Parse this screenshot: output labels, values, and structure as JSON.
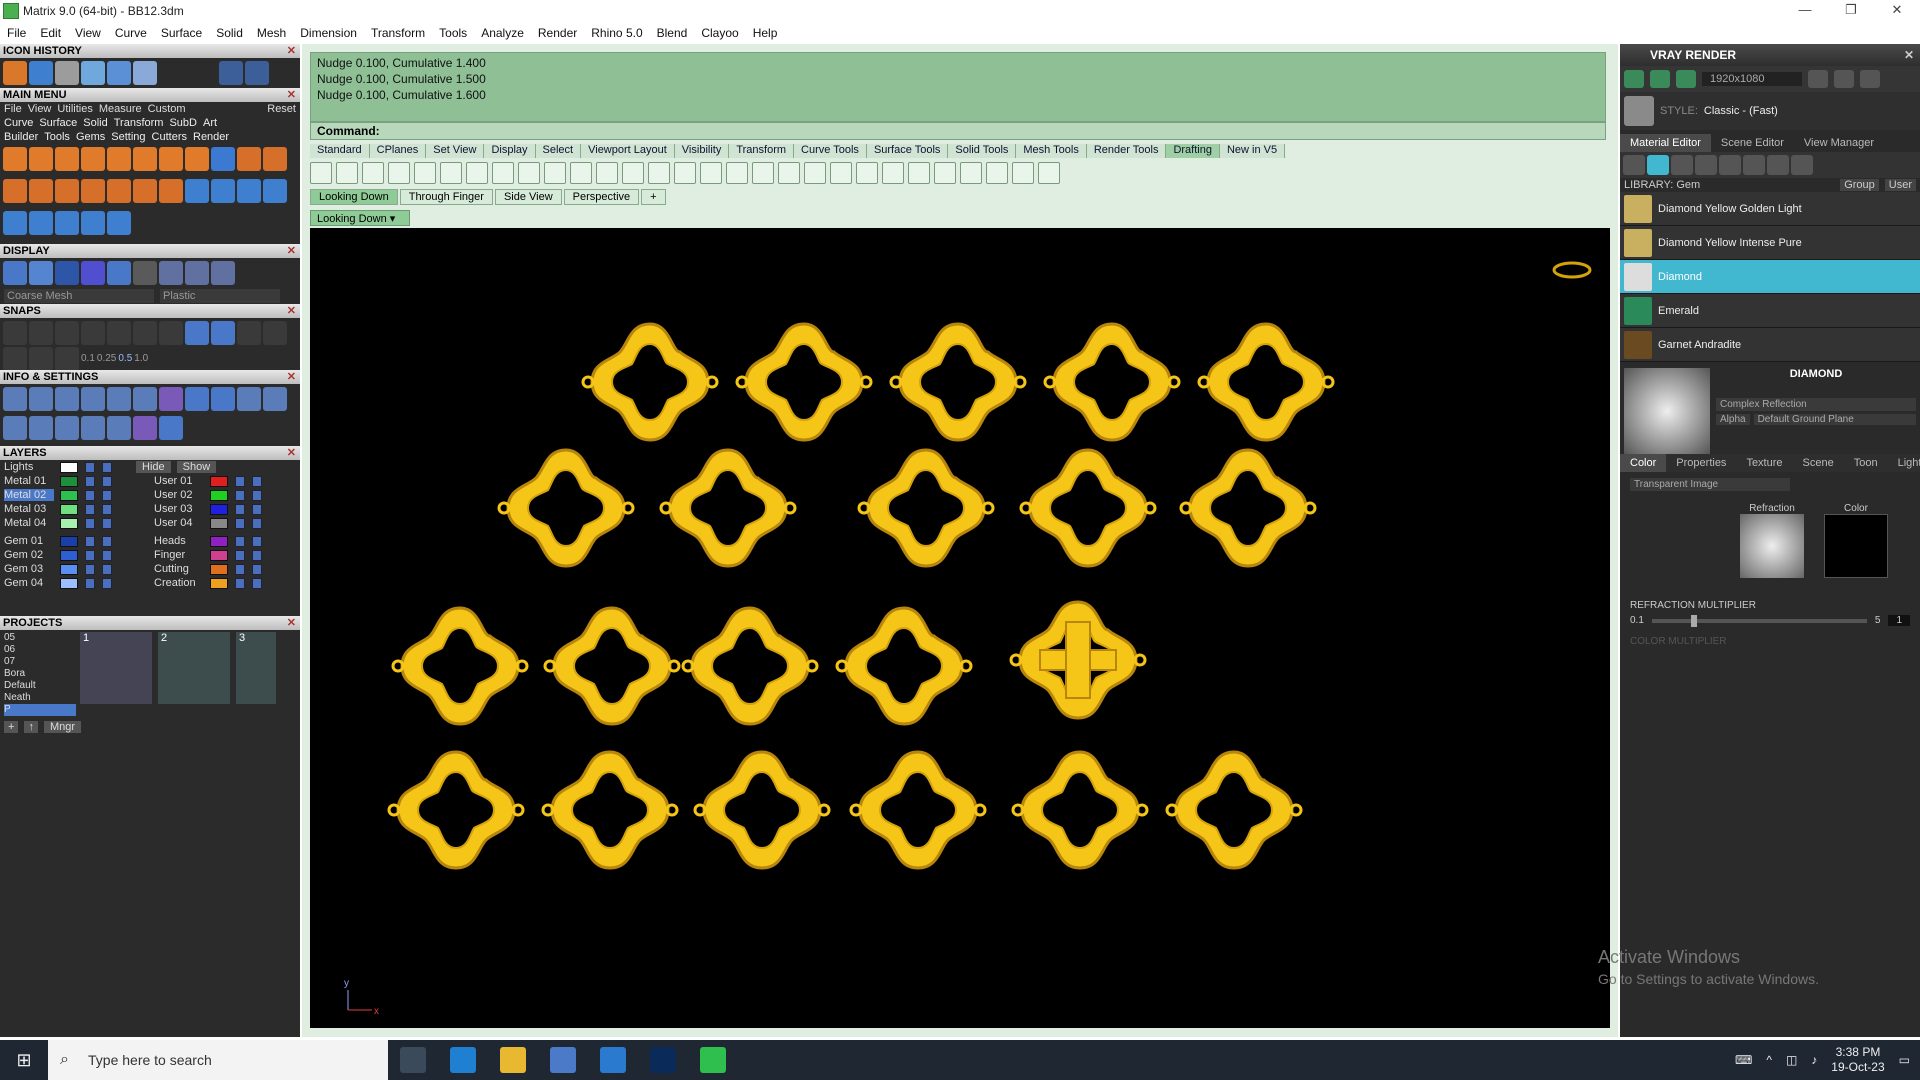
{
  "window": {
    "title": "Matrix 9.0 (64-bit) - BB12.3dm",
    "controls": [
      "—",
      "❐",
      "✕"
    ]
  },
  "menubar": [
    "File",
    "Edit",
    "View",
    "Curve",
    "Surface",
    "Solid",
    "Mesh",
    "Dimension",
    "Transform",
    "Tools",
    "Analyze",
    "Render",
    "Rhino 5.0",
    "Blend",
    "Clayoo",
    "Help"
  ],
  "left_panel": {
    "icon_history": "ICON HISTORY",
    "main_menu": "MAIN MENU",
    "main_menu_items": [
      "File",
      "View",
      "Utilities",
      "Measure",
      "Custom"
    ],
    "reset": "Reset",
    "categories_row1": [
      "Curve",
      "Surface",
      "Solid",
      "Transform",
      "SubD",
      "Art"
    ],
    "categories_row2": [
      "Builder",
      "Tools",
      "Gems",
      "Setting",
      "Cutters",
      "Render"
    ],
    "display": "DISPLAY",
    "mesh_mode": "Coarse Mesh",
    "material_mode": "Plastic",
    "snaps": "SNAPS",
    "snap_values": [
      "0.1",
      "0.25",
      "0.5",
      "1.0"
    ],
    "info_settings": "INFO & SETTINGS",
    "layers_title": "LAYERS",
    "lights_label": "Lights",
    "hide_label": "Hide",
    "show_label": "Show",
    "layers_left": [
      "Metal 01",
      "Metal 02",
      "Metal 03",
      "Metal 04",
      "Gem 01",
      "Gem 02",
      "Gem 03",
      "Gem 04"
    ],
    "layers_right": [
      "User 01",
      "User 02",
      "User 03",
      "User 04",
      "Heads",
      "Finger",
      "Cutting",
      "Creation"
    ],
    "projects_title": "PROJECTS",
    "projects_list": [
      "05",
      "06",
      "07",
      "Bora",
      "Default",
      "Neath",
      "P"
    ],
    "project_thumbs": [
      "1",
      "2",
      "3"
    ],
    "mngr": "Mngr"
  },
  "command": {
    "history": [
      "Nudge 0.100, Cumulative 1.400",
      "Nudge 0.100, Cumulative 1.500",
      "Nudge 0.100, Cumulative 1.600"
    ],
    "prompt": "Command:"
  },
  "toolbar_tabs": [
    "Standard",
    "CPlanes",
    "Set View",
    "Display",
    "Select",
    "Viewport Layout",
    "Visibility",
    "Transform",
    "Curve Tools",
    "Surface Tools",
    "Solid Tools",
    "Mesh Tools",
    "Render Tools",
    "Drafting",
    "New in V5"
  ],
  "viewport_tabs": [
    "Looking Down",
    "Through Finger",
    "Side View",
    "Perspective"
  ],
  "viewport_label": "Looking Down",
  "axis": {
    "y": "y",
    "x": "x"
  },
  "right_panel": {
    "title": "VRAY RENDER",
    "resolution": "1920x1080",
    "style_label": "STYLE:",
    "style_value": "Classic - (Fast)",
    "tabs": [
      "Material Editor",
      "Scene Editor",
      "View Manager"
    ],
    "library_label": "LIBRARY: Gem",
    "group_btn": "Group",
    "user_btn": "User",
    "library_items": [
      "Diamond Yellow Golden Light",
      "Diamond Yellow Intense Pure",
      "Diamond",
      "Emerald",
      "Garnet Andradite"
    ],
    "selected_index": 2,
    "material_name": "DIAMOND",
    "complex_reflection": "Complex Reflection",
    "alpha": "Alpha",
    "ground_plane": "Default Ground Plane",
    "sub_tabs": [
      "Color",
      "Properties",
      "Texture",
      "Scene",
      "Toon",
      "Lights"
    ],
    "transparent_image": "Transparent Image",
    "refraction_label": "Refraction",
    "color_label": "Color",
    "refraction_multiplier": "REFRACTION MULTIPLIER",
    "color_multiplier": "COLOR MULTIPLIER",
    "slider_min": "0.1",
    "slider_max": "5",
    "slider_value": "1"
  },
  "watermark": {
    "line1": "Activate Windows",
    "line2": "Go to Settings to activate Windows."
  },
  "taskbar": {
    "search_placeholder": "Type here to search",
    "time": "3:38 PM",
    "date": "19-Oct-23"
  },
  "colors": {
    "gold": "#f5c518",
    "gold_dark": "#b8860b",
    "viewport_bg": "#000000",
    "panel_bg": "#2b2b2b",
    "highlight": "#41b8d0"
  }
}
